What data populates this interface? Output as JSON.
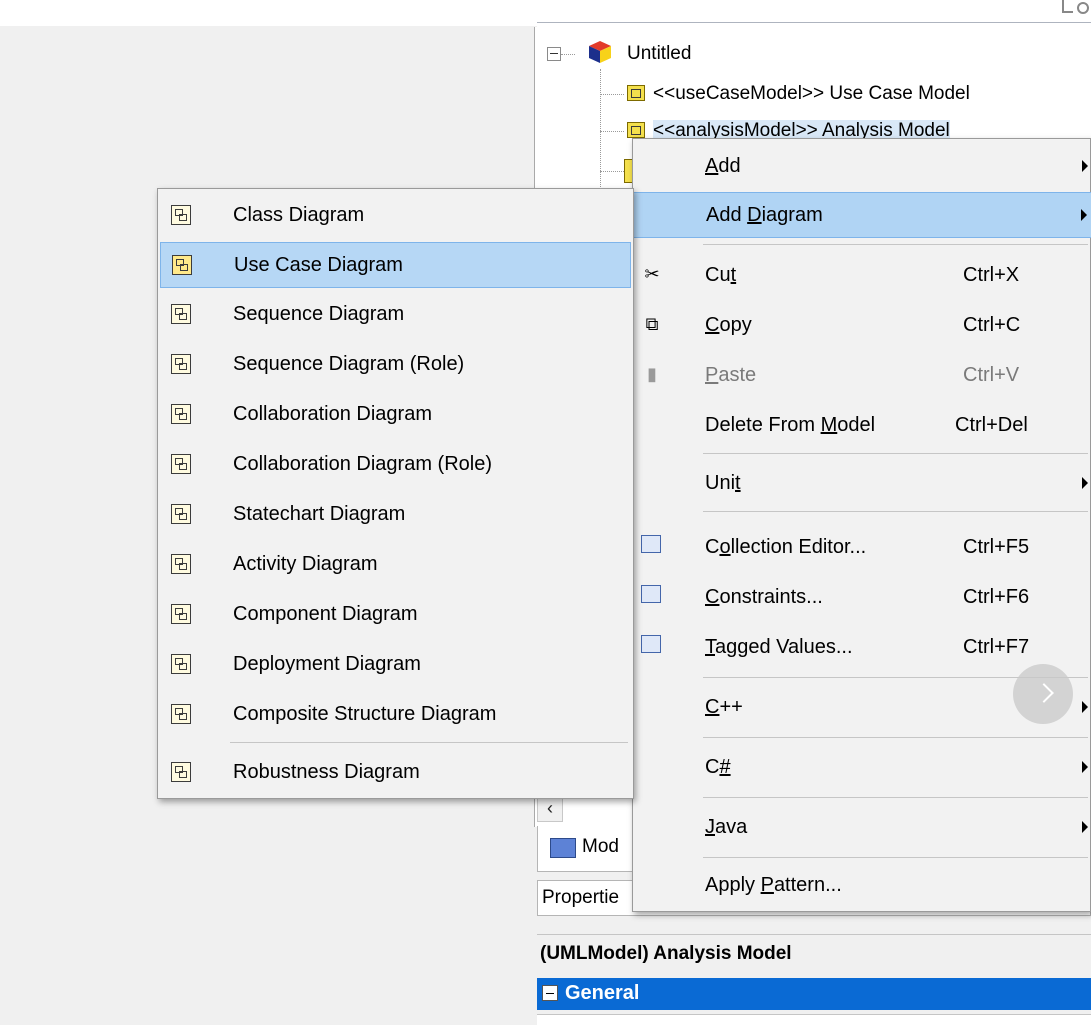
{
  "tree": {
    "root_label": "Untitled",
    "items": [
      {
        "label": "<<useCaseModel>> Use Case Model"
      },
      {
        "label": "<<analysisModel>> Analysis Model"
      }
    ]
  },
  "context_menu": {
    "items": [
      {
        "label": "Add",
        "mnemonic": "A",
        "rest": "dd",
        "shortcut": "",
        "submenu": true
      },
      {
        "label_pre": "Add ",
        "mnemonic": "D",
        "rest": "iagram",
        "shortcut": "",
        "submenu": true
      },
      {
        "label_pre": "Cu",
        "mnemonic": "t",
        "rest": "",
        "shortcut": "Ctrl+X",
        "icon": "scissors-icon"
      },
      {
        "label_pre": "",
        "mnemonic": "C",
        "rest": "opy",
        "shortcut": "Ctrl+C",
        "icon": "copy-icon"
      },
      {
        "label_pre": "",
        "mnemonic": "P",
        "rest": "aste",
        "shortcut": "Ctrl+V",
        "icon": "paste-icon",
        "disabled": true
      },
      {
        "label_pre": "Delete From ",
        "mnemonic": "M",
        "rest": "odel",
        "shortcut": "Ctrl+Del"
      },
      {
        "label_pre": "Uni",
        "mnemonic": "t",
        "rest": "",
        "shortcut": "",
        "submenu": true
      },
      {
        "label_pre": "C",
        "mnemonic": "o",
        "rest": "llection Editor...",
        "shortcut": "Ctrl+F5",
        "icon": "collection-editor-icon"
      },
      {
        "label_pre": "",
        "mnemonic": "C",
        "rest": "onstraints...",
        "shortcut": "Ctrl+F6",
        "icon": "constraints-icon"
      },
      {
        "label_pre": "",
        "mnemonic": "T",
        "rest": "agged Values...",
        "shortcut": "Ctrl+F7",
        "icon": "tagged-values-icon"
      },
      {
        "label_pre": "",
        "mnemonic": "C",
        "rest": "++",
        "shortcut": "",
        "submenu": true
      },
      {
        "label_pre": "C",
        "mnemonic": "#",
        "rest": "",
        "shortcut": "",
        "submenu": true
      },
      {
        "label_pre": "",
        "mnemonic": "J",
        "rest": "ava",
        "shortcut": "",
        "submenu": true
      },
      {
        "label_pre": "Apply ",
        "mnemonic": "P",
        "rest": "attern...",
        "shortcut": ""
      }
    ]
  },
  "submenu": {
    "items": [
      "Class Diagram",
      "Use Case Diagram",
      "Sequence Diagram",
      "Sequence Diagram (Role)",
      "Collaboration Diagram",
      "Collaboration Diagram (Role)",
      "Statechart Diagram",
      "Activity Diagram",
      "Component Diagram",
      "Deployment Diagram",
      "Composite Structure Diagram",
      "Robustness Diagram"
    ],
    "highlighted": "Use Case Diagram"
  },
  "bottom_panel": {
    "model_tab_label": "Mod",
    "properties_label": "Propertie",
    "header": "(UMLModel) Analysis Model",
    "group": "General"
  },
  "colors": {
    "menu_highlight": "#b0d4f4",
    "group_header": "#0a6ad4"
  }
}
